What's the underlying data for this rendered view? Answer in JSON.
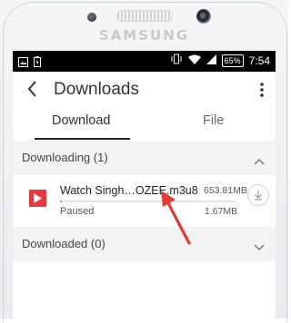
{
  "device": {
    "brand": "SAMSUNG"
  },
  "status_bar": {
    "battery": "65%",
    "time": "7:54"
  },
  "app_bar": {
    "title": "Downloads"
  },
  "tabs": [
    {
      "label": "Download",
      "active": true
    },
    {
      "label": "File",
      "active": false
    }
  ],
  "sections": {
    "downloading": {
      "label": "Downloading (1)",
      "expanded": true
    },
    "downloaded": {
      "label": "Downloaded (0)",
      "expanded": false
    }
  },
  "download_item": {
    "icon": "video-file-icon",
    "name": "Watch Singh…OZEE.m3u8",
    "total_size": "653.81MB",
    "status": "Paused",
    "downloaded_size": "1.67MB",
    "progress": 0.003
  },
  "colors": {
    "file_icon": "#e8383c",
    "annotation_arrow": "#e53935",
    "section_bg": "#f3f3f3"
  }
}
